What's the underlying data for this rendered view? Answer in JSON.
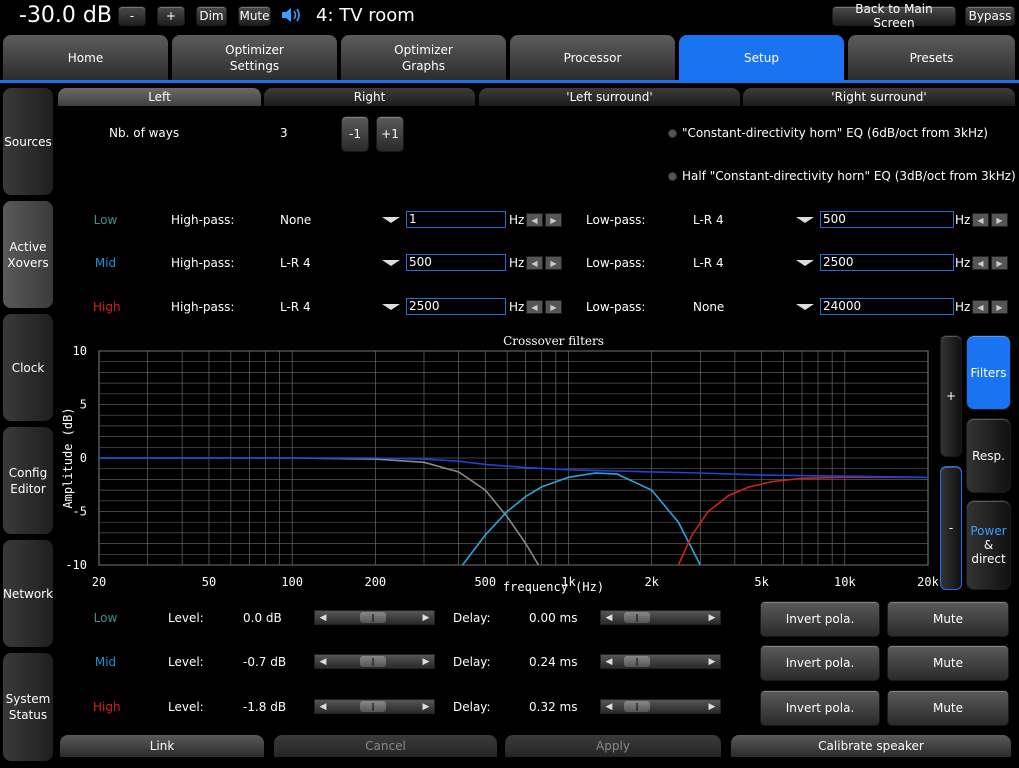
{
  "header": {
    "volume": "-30.0 dB",
    "minus_label": "-",
    "plus_label": "+",
    "dim_label": "Dim",
    "mute_label": "Mute",
    "room_title": "4: TV room",
    "back_label": "Back to Main Screen",
    "bypass_label": "Bypass"
  },
  "tabs": [
    {
      "label": "Home"
    },
    {
      "label": "Optimizer\nSettings"
    },
    {
      "label": "Optimizer\nGraphs"
    },
    {
      "label": "Processor"
    },
    {
      "label": "Setup"
    },
    {
      "label": "Presets"
    }
  ],
  "sidebar": [
    {
      "label": "Sources"
    },
    {
      "label": "Active\nXovers"
    },
    {
      "label": "Clock"
    },
    {
      "label": "Config\nEditor"
    },
    {
      "label": "Network"
    },
    {
      "label": "System\nStatus"
    }
  ],
  "subtabs": [
    {
      "label": "Left"
    },
    {
      "label": "Right"
    },
    {
      "label": "'Left surround'"
    },
    {
      "label": "'Right surround'"
    }
  ],
  "ways": {
    "label": "Nb. of ways",
    "value": "3",
    "minus": "-1",
    "plus": "+1"
  },
  "eq_options": [
    "\"Constant-directivity horn\" EQ (6dB/oct from 3kHz)",
    "Half \"Constant-directivity horn\" EQ (3dB/oct from 3kHz)"
  ],
  "hp_label": "High-pass:",
  "lp_label": "Low-pass:",
  "hz": "Hz",
  "bands": [
    {
      "name": "Low",
      "color": "#3f8f8f",
      "hp_type": "None",
      "hp_freq": "1",
      "lp_type": "L-R 4",
      "lp_freq": "500",
      "level": "0.0 dB",
      "delay": "0.00 ms",
      "level_pos": 0.46,
      "delay_pos": 0.12
    },
    {
      "name": "Mid",
      "color": "#1e90d8",
      "hp_type": "L-R 4",
      "hp_freq": "500",
      "lp_type": "L-R 4",
      "lp_freq": "2500",
      "level": "-0.7 dB",
      "delay": "0.24 ms",
      "level_pos": 0.46,
      "delay_pos": 0.12
    },
    {
      "name": "High",
      "color": "#cc2222",
      "hp_type": "L-R 4",
      "hp_freq": "2500",
      "lp_type": "None",
      "lp_freq": "24000",
      "level": "-1.8 dB",
      "delay": "0.32 ms",
      "level_pos": 0.46,
      "delay_pos": 0.12
    }
  ],
  "level_label": "Level:",
  "delay_label": "Delay:",
  "invert_label": "Invert pola.",
  "mute_label": "Mute",
  "side_controls": {
    "plus": "+",
    "minus": "-",
    "filters": "Filters",
    "resp": "Resp.",
    "power_line1": "Power",
    "power_line2": "& direct"
  },
  "footer": {
    "link": "Link",
    "cancel": "Cancel",
    "apply": "Apply",
    "calibrate": "Calibrate speaker"
  },
  "chart_data": {
    "type": "line",
    "title": "Crossover filters",
    "xlabel": "frequency (Hz)",
    "ylabel": "Amplitude (dB)",
    "xscale": "log",
    "xlim": [
      20,
      20000
    ],
    "ylim": [
      -10,
      10
    ],
    "xticks": [
      20,
      50,
      100,
      200,
      500,
      1000,
      2000,
      5000,
      10000,
      20000
    ],
    "xtick_labels": [
      "20",
      "50",
      "100",
      "200",
      "500",
      "1k",
      "2k",
      "5k",
      "10k",
      "20k"
    ],
    "yticks": [
      10,
      5,
      0,
      -5,
      -10
    ],
    "ytick_labels": [
      "10",
      "5",
      "0",
      "-5",
      "-10"
    ],
    "grid": true,
    "series": [
      {
        "color": "#888888",
        "x": [
          20,
          100,
          200,
          300,
          400,
          500,
          600,
          700,
          800
        ],
        "y": [
          0,
          0,
          -0.1,
          -0.4,
          -1.3,
          -3,
          -5.5,
          -8,
          -10.5
        ]
      },
      {
        "color": "#29a8d8",
        "x": [
          400,
          500,
          600,
          700,
          800,
          1000,
          1250,
          1500,
          2000,
          2500,
          3000
        ],
        "y": [
          -10.5,
          -7.2,
          -5,
          -3.6,
          -2.7,
          -1.8,
          -1.4,
          -1.5,
          -3,
          -6,
          -10
        ]
      },
      {
        "color": "#cc2222",
        "x": [
          2500,
          2800,
          3200,
          3800,
          4500,
          5500,
          7000,
          10000,
          20000
        ],
        "y": [
          -10,
          -7.2,
          -5,
          -3.5,
          -2.7,
          -2.2,
          -1.9,
          -1.8,
          -1.8
        ]
      },
      {
        "color": "#1a44d8",
        "x": [
          20,
          100,
          200,
          300,
          400,
          500,
          700,
          1000,
          2000,
          3000,
          5000,
          10000,
          20000
        ],
        "y": [
          0,
          0,
          0,
          -0.1,
          -0.3,
          -0.6,
          -0.9,
          -1.1,
          -1.3,
          -1.4,
          -1.6,
          -1.7,
          -1.8
        ]
      }
    ]
  }
}
